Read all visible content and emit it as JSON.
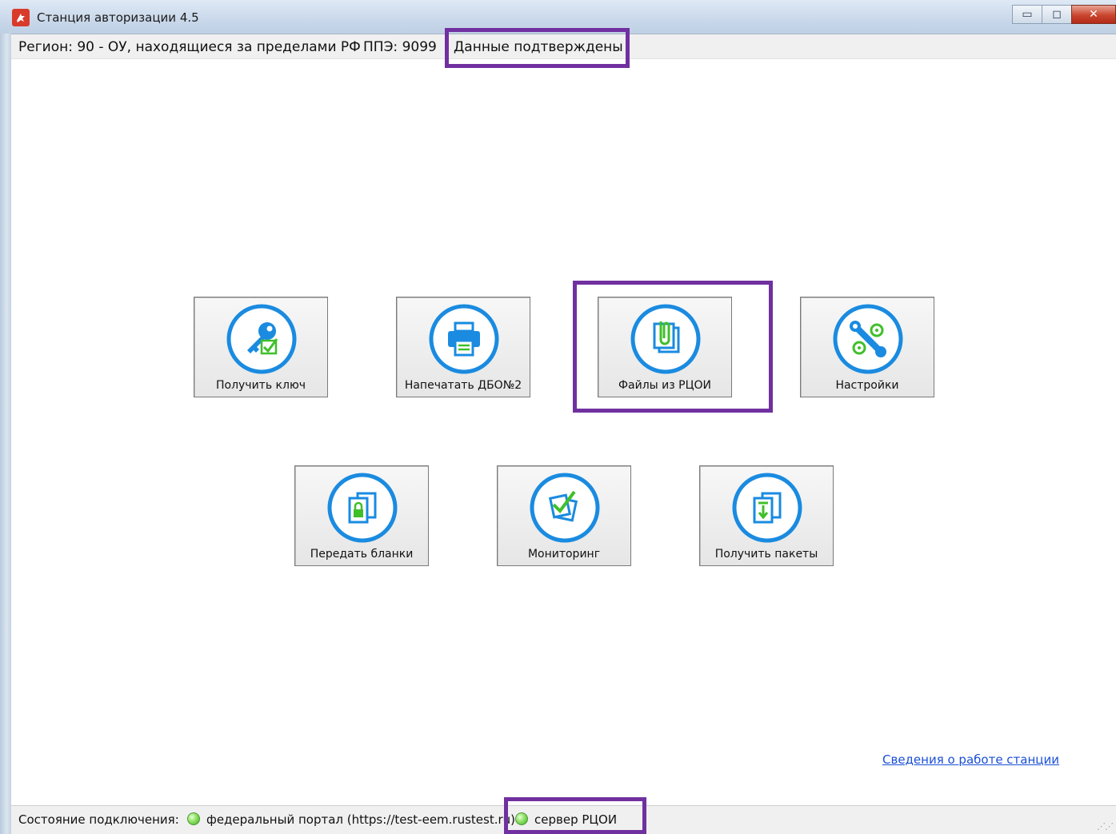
{
  "window": {
    "title": "Станция авторизации 4.5",
    "controls": {
      "minimize": "▭",
      "maximize": "◻",
      "close": "✕"
    }
  },
  "infobar": {
    "region": "Регион: 90 - ОУ, находящиеся за пределами РФ",
    "ppe": "ППЭ: 9099",
    "status": "Данные подтверждены"
  },
  "tiles": [
    {
      "label": "Получить ключ",
      "icon": "key-icon"
    },
    {
      "label": "Напечатать ДБО№2",
      "icon": "printer-icon"
    },
    {
      "label": "Файлы из РЦОИ",
      "icon": "paperclip-files-icon"
    },
    {
      "label": "Настройки",
      "icon": "wrench-settings-icon"
    },
    {
      "label": "Передать бланки",
      "icon": "locked-documents-icon"
    },
    {
      "label": "Мониторинг",
      "icon": "checked-documents-icon"
    },
    {
      "label": "Получить пакеты",
      "icon": "download-package-icon"
    }
  ],
  "link": {
    "text": "Сведения о работе станции"
  },
  "statusbar": {
    "label": "Состояние подключения:",
    "items": [
      {
        "text": "федеральный портал (https://test-eem.rustest.ru)",
        "status": "connected"
      },
      {
        "text": "сервер РЦОИ",
        "status": "connected"
      }
    ]
  },
  "colors": {
    "accent_blue": "#1a8be0",
    "icon_green": "#3fbf2a",
    "highlight": "#7030a0",
    "status_green": "#6ccf46"
  }
}
